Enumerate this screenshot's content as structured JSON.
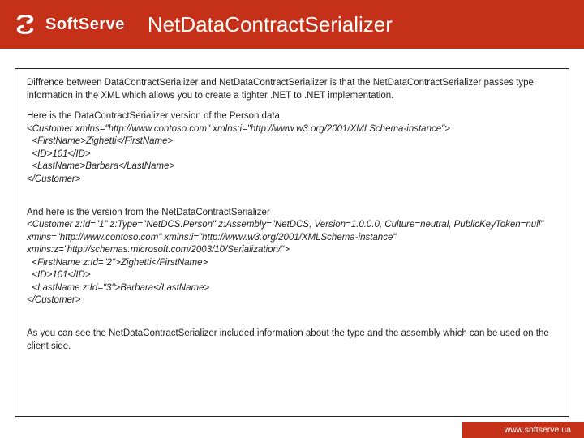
{
  "header": {
    "brand": "SoftServe",
    "title": "NetDataContractSerializer"
  },
  "content": {
    "intro": "Diffrence between DataContractSerializer and NetDataContractSerializer is that the NetDataContractSerializer passes type information in the XML which allows you to create a tighter .NET to .NET implementation.",
    "dcs_lead": "Here is the DataContractSerializer version of the Person data",
    "dcs_xml": [
      "<Customer xmlns=\"http://www.contoso.com\" xmlns:i=\"http://www.w3.org/2001/XMLSchema-instance\">",
      "  <FirstName>Zighetti</FirstName>",
      "  <ID>101</ID>",
      "  <LastName>Barbara</LastName>",
      "</Customer>",
      " "
    ],
    "ndcs_lead": "And here is the version from the NetDataContractSerializer",
    "ndcs_xml": [
      "<Customer z:Id=\"1\" z:Type=\"NetDCS.Person\" z:Assembly=\"NetDCS, Version=1.0.0.0, Culture=neutral, PublicKeyToken=null\" xmlns=\"http://www.contoso.com\" xmlns:i=\"http://www.w3.org/2001/XMLSchema-instance\" xmlns:z=\"http://schemas.microsoft.com/2003/10/Serialization/\">",
      "  <FirstName z:Id=\"2\">Zighetti</FirstName>",
      "  <ID>101</ID>",
      "  <LastName z:Id=\"3\">Barbara</LastName>",
      "</Customer>",
      " ",
      "",
      ""
    ],
    "outro": "As you can see the NetDataContractSerializer included information about the type and the assembly which can be used on the client side."
  },
  "footer": {
    "url": "www.softserve.ua"
  }
}
